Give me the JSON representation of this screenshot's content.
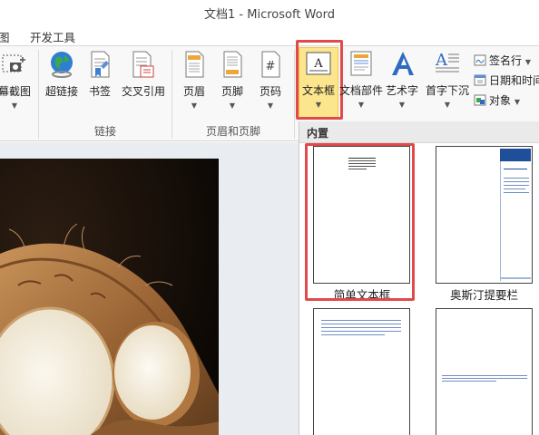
{
  "window": {
    "title": "文档1 - Microsoft Word"
  },
  "menu": {
    "tab_partial": "图",
    "tab_dev": "开发工具"
  },
  "ribbon": {
    "screenshot_label": "幕截图",
    "groups": {
      "links": {
        "label": "链接",
        "hyperlink": "超链接",
        "bookmark": "书签",
        "crossref": "交叉引用"
      },
      "header_footer": {
        "label": "页眉和页脚",
        "header": "页眉",
        "footer": "页脚",
        "page_number": "页码"
      },
      "text": {
        "textbox": "文本框",
        "quick_parts": "文档部件",
        "wordart": "艺术字",
        "drop_cap": "首字下沉",
        "signature": "签名行",
        "datetime": "日期和时间",
        "object": "对象"
      }
    }
  },
  "gallery": {
    "section_label": "内置",
    "items": [
      {
        "label": "简单文本框"
      },
      {
        "label": "奥斯汀提要栏"
      }
    ]
  },
  "colors": {
    "highlight_red": "#e04a4a",
    "active_yellow": "#fbe58d",
    "accent_blue": "#1f4e9a"
  }
}
